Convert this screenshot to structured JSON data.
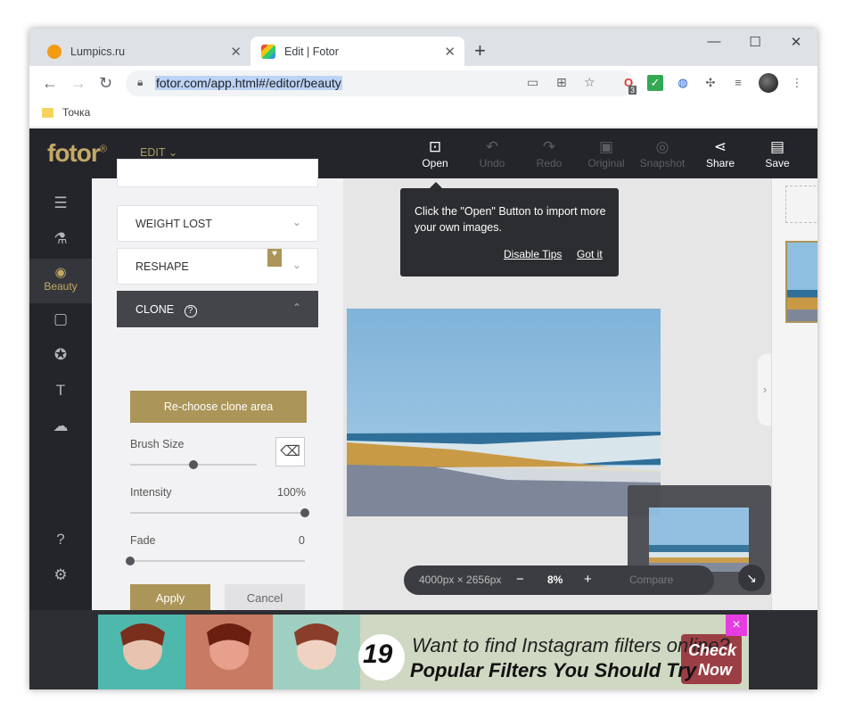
{
  "browser": {
    "tabs": [
      {
        "title": "Lumpics.ru",
        "active": false
      },
      {
        "title": "Edit | Fotor",
        "active": true
      }
    ],
    "new_tab": "+",
    "url": "fotor.com/app.html#/editor/beauty",
    "bookmark": "Точка",
    "extension_badge": "3"
  },
  "app": {
    "logo": "fotor",
    "logo_mark": "®",
    "edit_menu": "EDIT",
    "toolbar": {
      "open": "Open",
      "undo": "Undo",
      "redo": "Redo",
      "original": "Original",
      "snapshot": "Snapshot",
      "share": "Share",
      "save": "Save"
    },
    "sidebar": {
      "active_label": "Beauty"
    },
    "panel": {
      "weight_lost": "WEIGHT LOST",
      "reshape": "RESHAPE",
      "clone": "CLONE",
      "rechoose": "Re-choose clone area",
      "brush_size_label": "Brush Size",
      "brush_size": 0.5,
      "intensity_label": "Intensity",
      "intensity_value": "100%",
      "intensity": 1.0,
      "fade_label": "Fade",
      "fade_value": "0",
      "fade": 0.0,
      "apply": "Apply",
      "cancel": "Cancel"
    },
    "tip": {
      "text": "Click the \"Open\" Button to import more your own images.",
      "disable": "Disable Tips",
      "got_it": "Got it"
    },
    "zoom": {
      "dimensions": "4000px × 2656px",
      "minus": "−",
      "level": "8%",
      "plus": "+",
      "compare": "Compare"
    },
    "ad": {
      "number": "19",
      "line1": "Want to find Instagram filters online?",
      "line2": "Popular Filters You Should Try",
      "cta1": "Check",
      "cta2": "Now",
      "close": "×"
    }
  },
  "colors": {
    "gold": "#ab9558",
    "dark": "#24252b",
    "accent_magenta": "#e63de0"
  }
}
